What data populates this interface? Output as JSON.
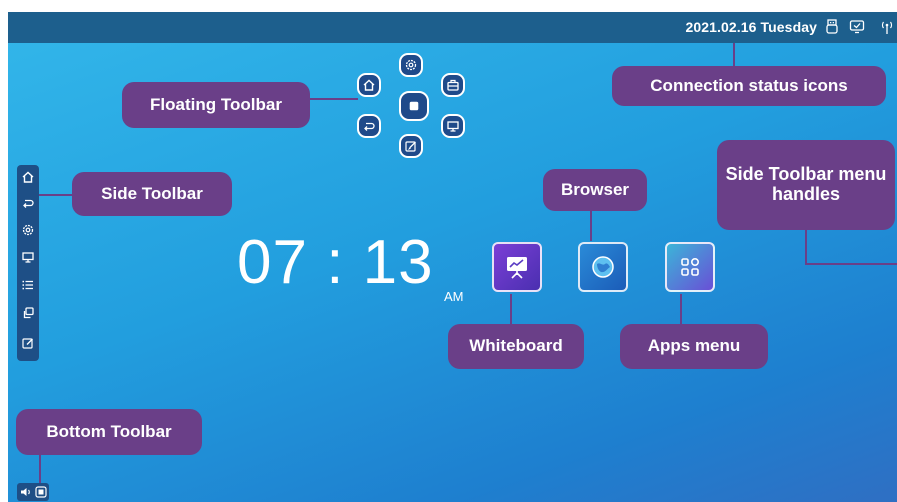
{
  "status_bar": {
    "date": "2021.02.16 Tuesday",
    "icons": [
      "usb-icon",
      "screen-share-icon",
      "wireless-icon"
    ]
  },
  "callouts": {
    "floating_toolbar": "Floating Toolbar",
    "connection_status": "Connection status icons",
    "side_toolbar": "Side Toolbar",
    "browser": "Browser",
    "side_toolbar_handles": "Side Toolbar menu handles",
    "whiteboard": "Whiteboard",
    "apps_menu": "Apps menu",
    "bottom_toolbar": "Bottom Toolbar"
  },
  "floating_toolbar": {
    "buttons": [
      "settings-icon",
      "home-icon",
      "toolbox-icon",
      "stop-icon",
      "back-icon",
      "display-icon",
      "annotate-icon"
    ]
  },
  "side_toolbar": {
    "buttons": [
      "home-icon",
      "back-icon",
      "settings-icon",
      "display-icon",
      "list-icon",
      "windows-icon",
      "annotate-icon"
    ]
  },
  "clock": {
    "time": "07 : 13",
    "ampm": "AM"
  },
  "apps": [
    {
      "name": "Whiteboard",
      "icon": "whiteboard-icon"
    },
    {
      "name": "Browser",
      "icon": "globe-icon"
    },
    {
      "name": "Apps menu",
      "icon": "apps-grid-icon"
    }
  ],
  "bottom_toolbar": {
    "buttons": [
      "volume-icon",
      "record-icon"
    ]
  },
  "colors": {
    "callout": "#6a3f88",
    "topbar": "#1d5f8d",
    "toolbar": "#1f4a8a"
  }
}
